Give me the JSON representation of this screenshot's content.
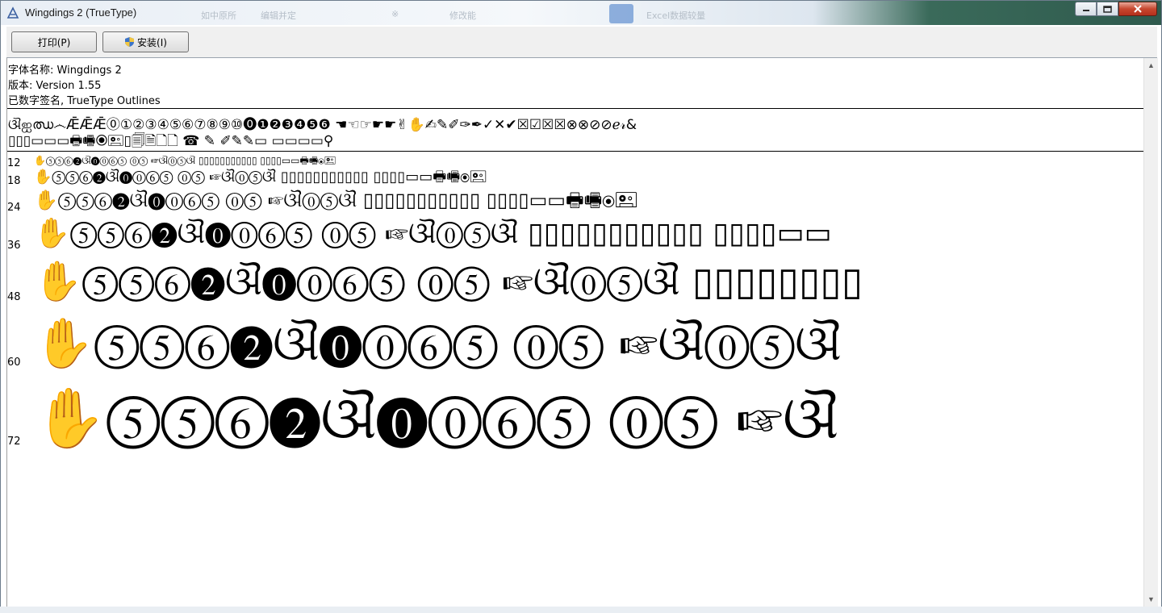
{
  "window": {
    "title": "Wingdings 2 (TrueType)"
  },
  "background_ghost": {
    "items": [
      "如中原所",
      "编辑并定",
      "※",
      "修改能",
      "Excel数据较量"
    ]
  },
  "toolbar": {
    "print_label": "打印(P)",
    "install_label": "安装(I)"
  },
  "font_info": {
    "name_line": "字体名称: Wingdings 2",
    "version_line": "版本: Version 1.55",
    "signature_line": "已数字签名, TrueType Outlines"
  },
  "charset": {
    "line1": "ଔஐഝ෴ǢǢǢ⓪①②③④⑤⑥⑦⑧⑨⑩⓿❶❷❸❹❺❻  ☚☜☞☛☛✌✋✍✎✐✑✒✓✕✔☒☑☒☒⊗⊗⊘⊘ℯ𝓇&",
    "line2": "▯▯▯▭▭▭🖶🖷⦿🖭▯🗐🗎🗋🗋  ☎  ✎  ✐✎✎▭  ▭▭▭▭⚲"
  },
  "samples": [
    {
      "size": "12",
      "text": "✋⑤⑤⑥❷ଔ⓿⓪⑥⑤  ⓪⑤  ☞ଔ⓪⑤ଔ  ▯▯▯▯▯▯▯▯▯▯▯  ▯▯▯▯▭▭🖶🖷⦿🖭"
    },
    {
      "size": "18",
      "text": "✋⑤⑤⑥❷ଔ⓿⓪⑥⑤  ⓪⑤  ☞ଔ⓪⑤ଔ  ▯▯▯▯▯▯▯▯▯▯▯  ▯▯▯▯▭▭🖶🖷⦿🖭"
    },
    {
      "size": "24",
      "text": "✋⑤⑤⑥❷ଔ⓿⓪⑥⑤  ⓪⑤  ☞ଔ⓪⑤ଔ  ▯▯▯▯▯▯▯▯▯▯▯  ▯▯▯▯▭▭🖶🖷⦿🖭"
    },
    {
      "size": "36",
      "text": "✋⑤⑤⑥❷ଔ⓿⓪⑥⑤  ⓪⑤  ☞ଔ⓪⑤ଔ  ▯▯▯▯▯▯▯▯▯▯▯  ▯▯▯▯▭▭"
    },
    {
      "size": "48",
      "text": "✋⑤⑤⑥❷ଔ⓿⓪⑥⑤  ⓪⑤  ☞ଔ⓪⑤ଔ  ▯▯▯▯▯▯▯▯"
    },
    {
      "size": "60",
      "text": "✋⑤⑤⑥❷ଔ⓿⓪⑥⑤  ⓪⑤  ☞ଔ⓪⑤ଔ"
    },
    {
      "size": "72",
      "text": "✋⑤⑤⑥❷ଔ⓿⓪⑥⑤  ⓪⑤  ☞ଔ"
    }
  ]
}
